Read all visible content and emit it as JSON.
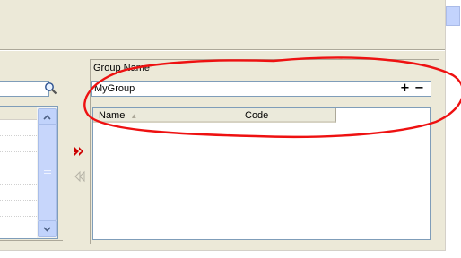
{
  "group_panel": {
    "label": "Group Name",
    "value": "MyGroup",
    "add_label": "+",
    "remove_label": "−"
  },
  "members_table": {
    "columns": [
      {
        "label": "Name",
        "sort_icon": "▲"
      },
      {
        "label": "Code"
      }
    ],
    "rows": []
  },
  "left_panel": {
    "search_value": "",
    "list_items": []
  },
  "transfer": {
    "add_icon": "double-right-arrow-icon",
    "remove_icon": "double-left-arrow-icon"
  },
  "colors": {
    "window_bg": "#ece9d8",
    "input_border": "#7f9db9",
    "scrollbar": "#c1d3fb",
    "annotation": "#ee1111",
    "add_arrow": "#cc0000"
  }
}
